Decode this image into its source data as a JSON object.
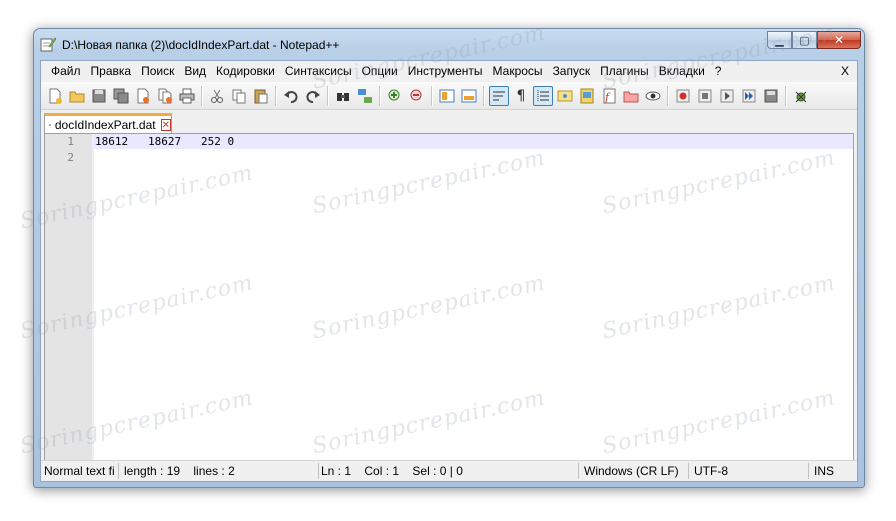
{
  "window": {
    "title": "D:\\Новая папка (2)\\docIdIndexPart.dat - Notepad++",
    "icon": "notepadpp-icon",
    "controls": {
      "minimize": "▁",
      "maximize": "▢",
      "close": "✕"
    }
  },
  "menu": {
    "items": [
      "Файл",
      "Правка",
      "Поиск",
      "Вид",
      "Кодировки",
      "Синтаксисы",
      "Опции",
      "Инструменты",
      "Макросы",
      "Запуск",
      "Плагины",
      "Вкладки",
      "?"
    ],
    "close_doc": "X"
  },
  "toolbar": {
    "buttons": [
      "new-file-icon",
      "open-file-icon",
      "save-icon",
      "save-all-icon",
      "close-icon",
      "close-all-icon",
      "print-icon",
      "cut-icon",
      "copy-icon",
      "paste-icon",
      "undo-icon",
      "redo-icon",
      "find-icon",
      "replace-icon",
      "zoom-in-icon",
      "zoom-out-icon",
      "sync-vertical-icon",
      "sync-horizontal-icon",
      "word-wrap-icon",
      "show-all-chars-icon",
      "indent-guide-icon",
      "user-lang-icon",
      "doc-map-icon",
      "function-list-icon",
      "folder-workspace-icon",
      "monitor-icon",
      "record-macro-icon",
      "stop-record-icon",
      "play-macro-icon",
      "run-macro-multiple-icon",
      "save-macro-icon",
      "plugin-icon"
    ]
  },
  "tab": {
    "label": "docIdIndexPart.dat",
    "close": "✕"
  },
  "editor": {
    "lines": [
      {
        "num": "1",
        "text": "18612   18627   252 0"
      },
      {
        "num": "2",
        "text": ""
      }
    ]
  },
  "status": {
    "lang": "Normal text fi",
    "length": "length : 19",
    "lines": "lines : 2",
    "ln": "Ln : 1",
    "col": "Col : 1",
    "sel": "Sel : 0 | 0",
    "eol": "Windows (CR LF)",
    "encoding": "UTF-8",
    "mode": "INS"
  },
  "watermark": "Soringpcrepair.com"
}
